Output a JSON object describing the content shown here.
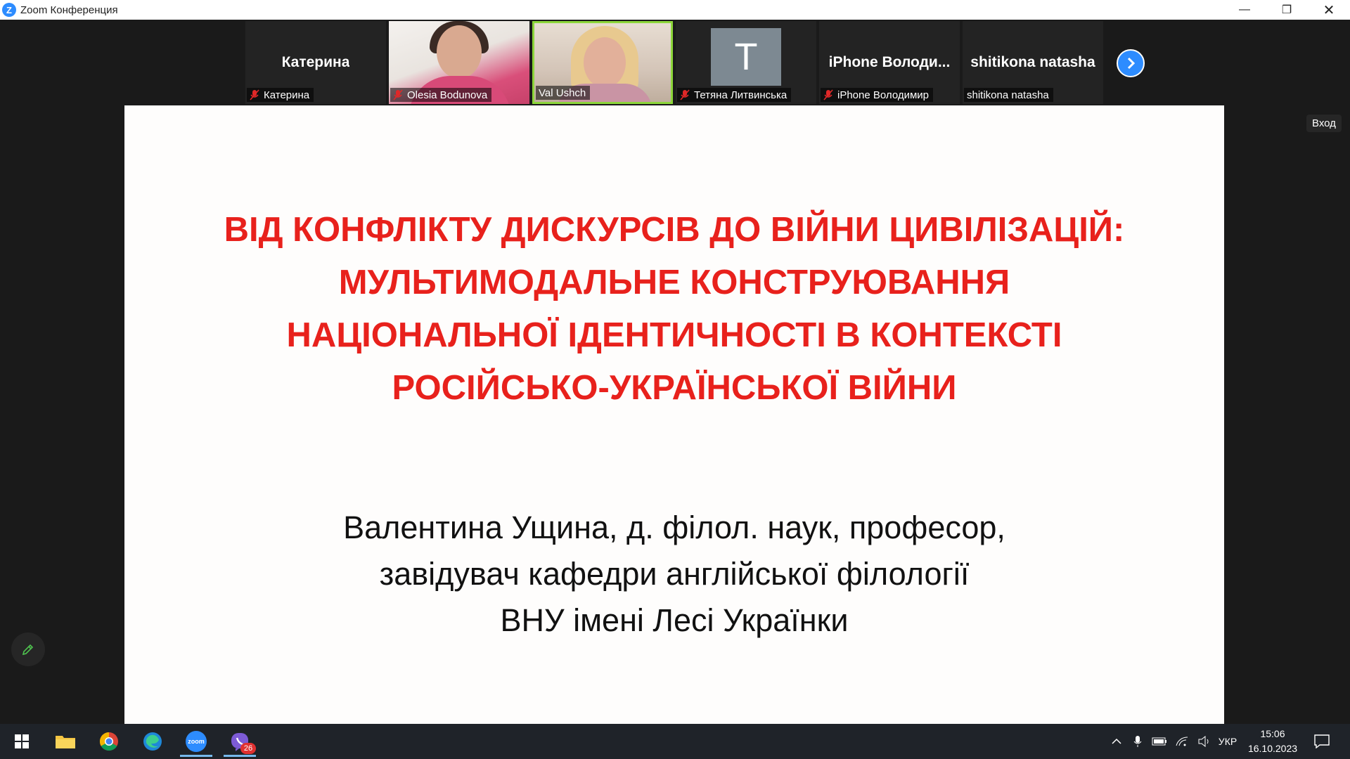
{
  "window": {
    "app_logo": "Z",
    "title": "Zoom Конференция",
    "controls": {
      "minimize": "—",
      "restore": "❐",
      "close": "✕"
    }
  },
  "participants": [
    {
      "display": "Катерина",
      "label": "Катерина",
      "muted": true,
      "video": false
    },
    {
      "display": "",
      "label": "Olesia Bodunova",
      "muted": true,
      "video": true
    },
    {
      "display": "",
      "label": "Val Ushch",
      "muted": false,
      "video": true,
      "active_speaker": true
    },
    {
      "display": "T",
      "label": "Тетяна Литвинська",
      "muted": true,
      "video": false
    },
    {
      "display": "iPhone Володи...",
      "label": "iPhone Володимир",
      "muted": true,
      "video": false
    },
    {
      "display": "shitikona natasha",
      "label": "shitikona natasha",
      "muted": false,
      "video": false
    }
  ],
  "strip": {
    "next_icon": "chevron-right-icon"
  },
  "vhod_label": "Вход",
  "slide": {
    "title_lines": [
      "ВІД КОНФЛІКТУ ДИСКУРСІВ ДО ВІЙНИ ЦИВІЛІЗАЦІЙ:",
      "МУЛЬТИМОДАЛЬНЕ КОНСТРУЮВАННЯ",
      "НАЦІОНАЛЬНОЇ ІДЕНТИЧНОСТІ В КОНТЕКСТІ",
      "РОСІЙСЬКО-УКРАЇНСЬКОЇ ВІЙНИ"
    ],
    "author_lines": [
      "Валентина Ущина, д. філол. наук, професор,",
      "завідувач кафедри англійської філології",
      "ВНУ імені Лесі Українки"
    ],
    "title_color": "#e8211c"
  },
  "taskbar": {
    "apps": [
      "windows-start-icon",
      "file-explorer-icon",
      "chrome-icon",
      "edge-icon",
      "zoom-icon",
      "viber-icon"
    ],
    "zoom_label": "zoom",
    "viber_badge": "26",
    "language": "УКР",
    "time": "15:06",
    "date": "16.10.2023"
  }
}
